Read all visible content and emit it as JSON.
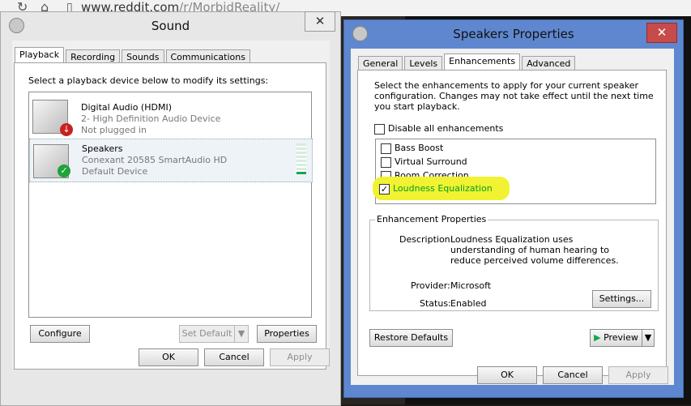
{
  "browser": {
    "back_glyph": "↻",
    "home_glyph": "⌂",
    "page_glyph": "▯",
    "url_main": "www.reddit.com",
    "url_path": "/r/MorbidReality/"
  },
  "sound_window": {
    "title": "Sound",
    "close": "✕",
    "tabs": [
      {
        "label": "Playback"
      },
      {
        "label": "Recording"
      },
      {
        "label": "Sounds"
      },
      {
        "label": "Communications"
      }
    ],
    "instruction": "Select a playback device below to modify its settings:",
    "devices": [
      {
        "name": "Digital Audio (HDMI)",
        "line2": "2- High Definition Audio Device",
        "line3": "Not plugged in",
        "badge_glyph": "↓",
        "badge_color": "#c82020"
      },
      {
        "name": "Speakers",
        "line2": "Conexant 20585 SmartAudio HD",
        "line3": "Default Device",
        "badge_glyph": "✓",
        "badge_color": "#1fa33a"
      }
    ],
    "buttons": {
      "configure": "Configure",
      "set_default": "Set Default",
      "set_default_arrow": "▼",
      "properties": "Properties",
      "ok": "OK",
      "cancel": "Cancel",
      "apply": "Apply"
    }
  },
  "speakers_window": {
    "title": "Speakers Properties",
    "close": "✕",
    "tabs": [
      {
        "label": "General"
      },
      {
        "label": "Levels"
      },
      {
        "label": "Enhancements"
      },
      {
        "label": "Advanced"
      }
    ],
    "instruction": "Select the enhancements to apply for your current speaker configuration. Changes may not take effect until the next time you start playback.",
    "disable_all": "Disable all enhancements",
    "enhancements": [
      {
        "label": "Bass Boost",
        "checked": false
      },
      {
        "label": "Virtual Surround",
        "checked": false
      },
      {
        "label": "Room Correction",
        "checked": false
      },
      {
        "label": "Loudness Equalization",
        "checked": true
      }
    ],
    "properties": {
      "title": "Enhancement Properties",
      "description_label": "Description:",
      "description": "Loudness Equalization uses understanding of human hearing to reduce perceived volume differences.",
      "provider_label": "Provider:",
      "provider": "Microsoft",
      "status_label": "Status:",
      "status": "Enabled",
      "settings": "Settings..."
    },
    "buttons": {
      "restore": "Restore Defaults",
      "preview": "Preview",
      "preview_arrow": "▼",
      "ok": "OK",
      "cancel": "Cancel",
      "apply": "Apply"
    }
  },
  "colors": {
    "highlight": "#f1f232",
    "selected_text": "#00a020",
    "checkmark": "#111111"
  }
}
